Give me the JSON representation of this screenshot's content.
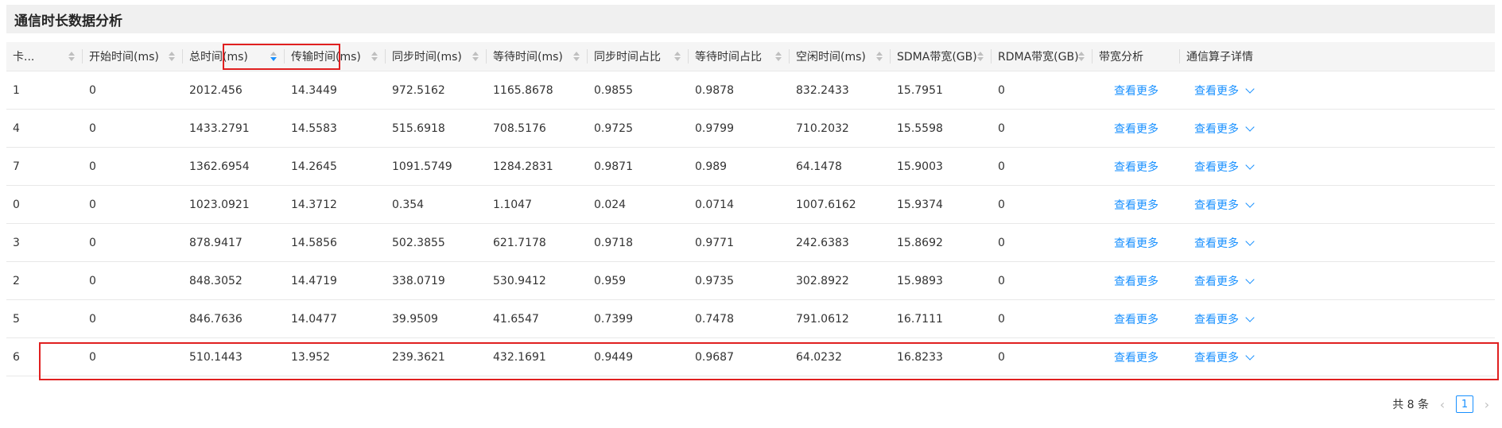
{
  "section": {
    "title": "通信时长数据分析"
  },
  "table": {
    "columns": [
      {
        "key": "card",
        "label": "卡...",
        "sortable": true
      },
      {
        "key": "start",
        "label": "开始时间(ms)",
        "sortable": true
      },
      {
        "key": "total",
        "label": "总时间(ms)",
        "sortable": true,
        "active": true
      },
      {
        "key": "transfer",
        "label": "传输时间(ms)",
        "sortable": true
      },
      {
        "key": "sync",
        "label": "同步时间(ms)",
        "sortable": true
      },
      {
        "key": "wait",
        "label": "等待时间(ms)",
        "sortable": true
      },
      {
        "key": "sync_ratio",
        "label": "同步时间占比",
        "sortable": true
      },
      {
        "key": "wait_ratio",
        "label": "等待时间占比",
        "sortable": true
      },
      {
        "key": "idle",
        "label": "空闲时间(ms)",
        "sortable": true
      },
      {
        "key": "sdma",
        "label": "SDMA带宽(GB)",
        "sortable": true
      },
      {
        "key": "rdma",
        "label": "RDMA带宽(GB)",
        "sortable": true
      },
      {
        "key": "bw_analysis",
        "label": "带宽分析",
        "sortable": false
      },
      {
        "key": "op_details",
        "label": "通信算子详情",
        "sortable": false
      }
    ],
    "link_label": "查看更多",
    "rows": [
      [
        "1",
        "0",
        "2012.456",
        "14.3449",
        "972.5162",
        "1165.8678",
        "0.9855",
        "0.9878",
        "832.2433",
        "15.7951",
        "0"
      ],
      [
        "4",
        "0",
        "1433.2791",
        "14.5583",
        "515.6918",
        "708.5176",
        "0.9725",
        "0.9799",
        "710.2032",
        "15.5598",
        "0"
      ],
      [
        "7",
        "0",
        "1362.6954",
        "14.2645",
        "1091.5749",
        "1284.2831",
        "0.9871",
        "0.989",
        "64.1478",
        "15.9003",
        "0"
      ],
      [
        "0",
        "0",
        "1023.0921",
        "14.3712",
        "0.354",
        "1.1047",
        "0.024",
        "0.0714",
        "1007.6162",
        "15.9374",
        "0"
      ],
      [
        "3",
        "0",
        "878.9417",
        "14.5856",
        "502.3855",
        "621.7178",
        "0.9718",
        "0.9771",
        "242.6383",
        "15.8692",
        "0"
      ],
      [
        "2",
        "0",
        "848.3052",
        "14.4719",
        "338.0719",
        "530.9412",
        "0.959",
        "0.9735",
        "302.8922",
        "15.9893",
        "0"
      ],
      [
        "5",
        "0",
        "846.7636",
        "14.0477",
        "39.9509",
        "41.6547",
        "0.7399",
        "0.7478",
        "791.0612",
        "16.7111",
        "0"
      ],
      [
        "6",
        "0",
        "510.1443",
        "13.952",
        "239.3621",
        "432.1691",
        "0.9449",
        "0.9687",
        "64.0232",
        "16.8233",
        "0"
      ]
    ]
  },
  "pagination": {
    "total_label": "共 8 条",
    "prev": "‹",
    "current": "1",
    "next": "›"
  },
  "colors": {
    "link": "#1890ff",
    "highlight": "#e02020",
    "header_bg": "#f5f5f5"
  }
}
